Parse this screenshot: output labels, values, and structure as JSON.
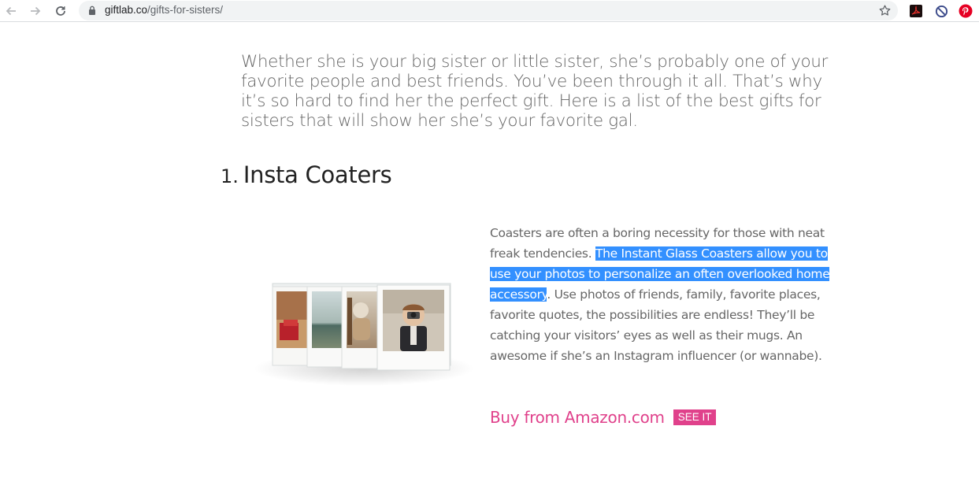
{
  "browser": {
    "url_domain": "giftlab.co",
    "url_path": "/gifts-for-sisters/",
    "icons": {
      "back": "arrow-left-icon",
      "forward": "arrow-right-icon",
      "reload": "reload-icon",
      "lock": "lock-icon",
      "bookmark": "star-icon",
      "ext1": "adobe-pdf-icon",
      "ext2": "block-icon",
      "ext3": "pinterest-icon"
    }
  },
  "article": {
    "intro": "Whether she is your big sister or little sister, she’s probably one of your favorite people and best friends. You’ve been through it all. That’s why it’s so hard to find her the perfect gift. Here is a list of the best gifts for sisters that will show her she’s your favorite gal.",
    "item": {
      "number": "1.",
      "title": "Insta Coaters",
      "desc_before": "Coasters are often a boring necessity for those with neat freak tendencies. ",
      "desc_highlight": "The Instant Glass Coasters allow you to use your photos to personalize an often overlooked home accessory",
      "desc_after": ". Use photos of friends, family, favorite places, favorite quotes, the possibilities are endless! They’ll be catching your visitors’ eyes as well as their mugs. An awesome if she’s an Instagram influencer (or wannabe).",
      "buy_label": "Buy from Amazon.com",
      "see_it_label": "SEE IT"
    }
  },
  "colors": {
    "accent_pink": "#e0418b",
    "selection": "#3390ff",
    "body_text": "#666666"
  }
}
